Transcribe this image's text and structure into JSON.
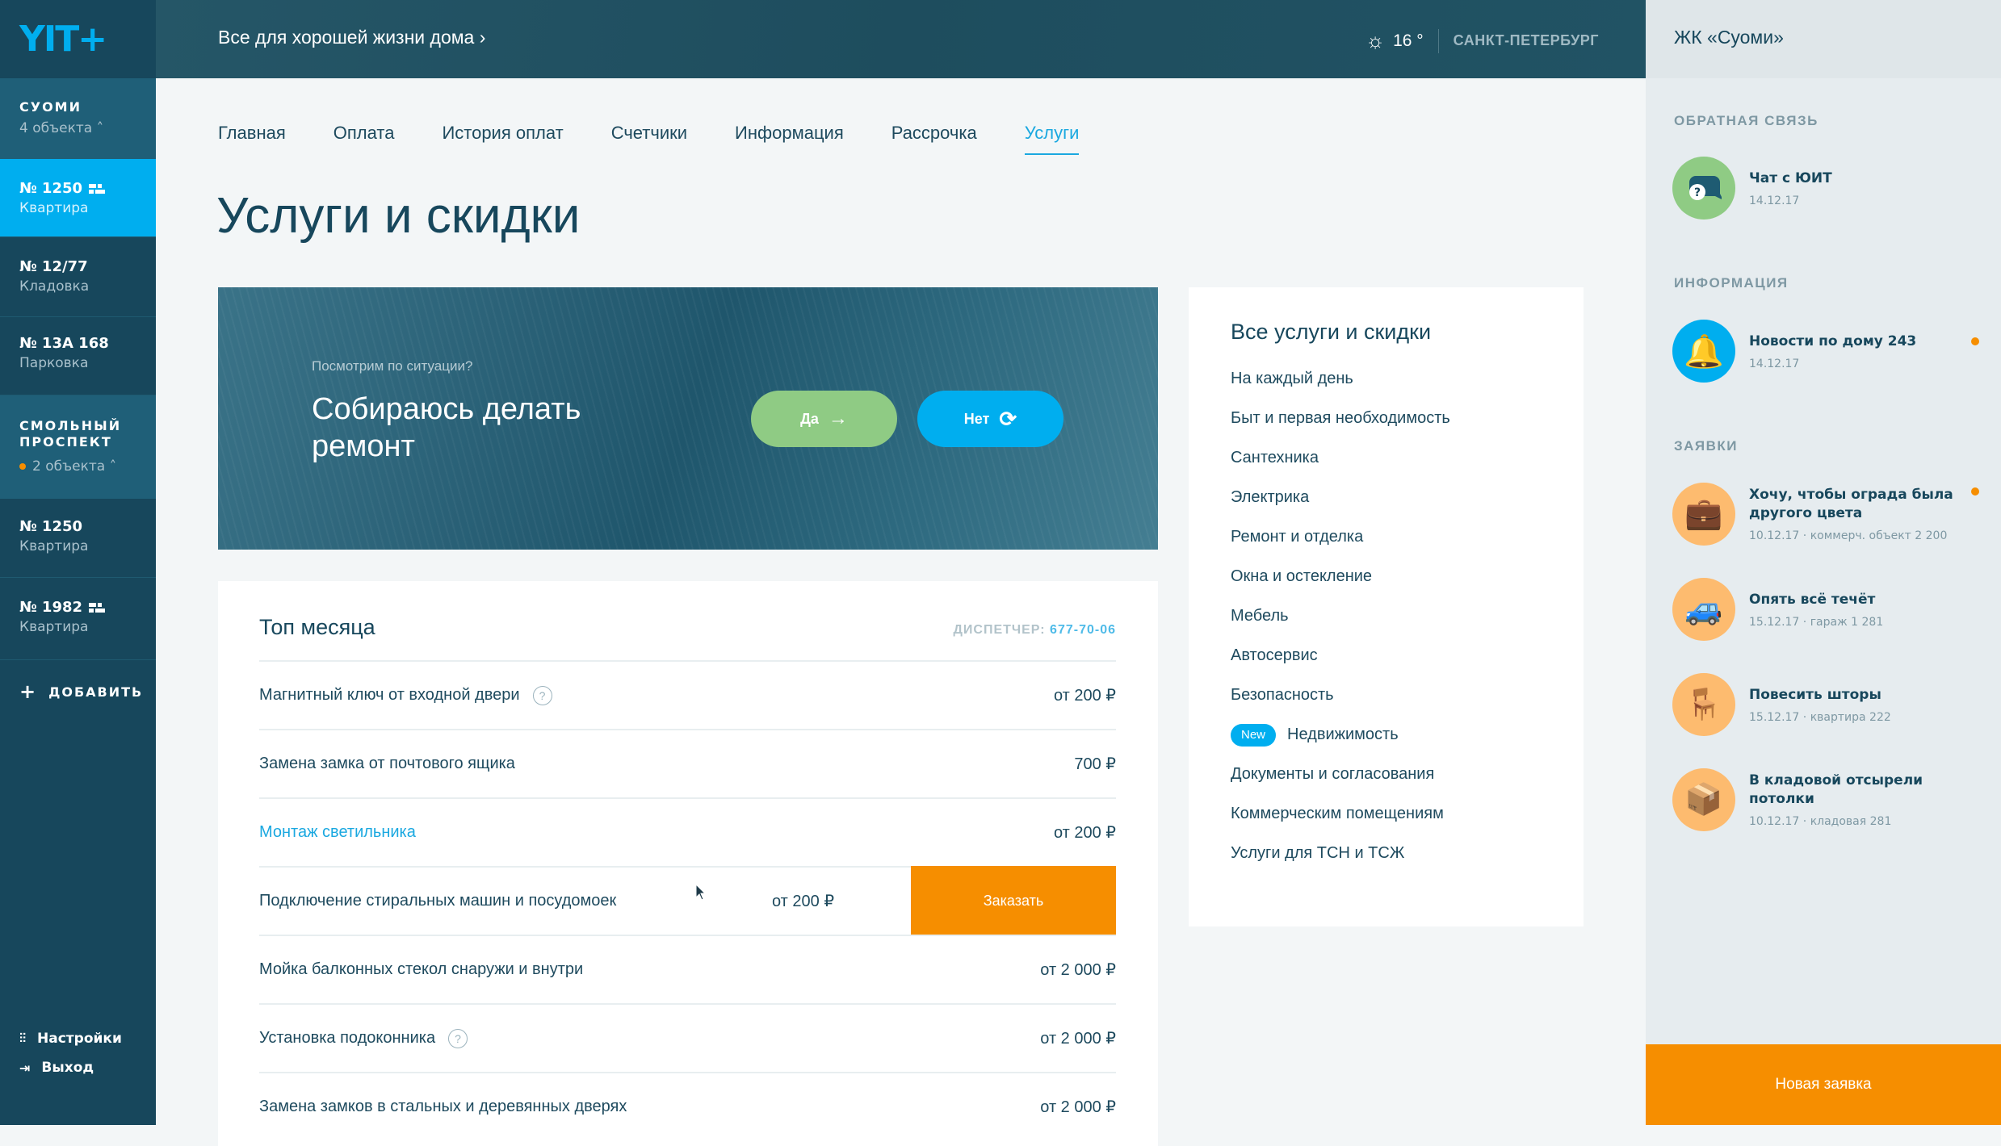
{
  "logo": "YIT+",
  "header": {
    "tagline": "Все для хорошей жизни дома",
    "temperature": "16 °",
    "city": "САНКТ-ПЕТЕРБУРГ"
  },
  "sidebar": {
    "groups": [
      {
        "title": "СУОМИ",
        "count": "4 объекта"
      },
      {
        "title": "СМОЛЬНЫЙ ПРОСПЕКТ",
        "count": "2 объекта"
      }
    ],
    "items": [
      {
        "number": "№ 1250",
        "kind": "Квартира"
      },
      {
        "number": "№ 12/77",
        "kind": "Кладовка"
      },
      {
        "number": "№ 13А 168",
        "kind": "Парковка"
      },
      {
        "number": "№ 1250",
        "kind": "Квартира"
      },
      {
        "number": "№ 1982",
        "kind": "Квартира"
      }
    ],
    "add": "ДОБАВИТЬ",
    "settings": "Настройки",
    "logout": "Выход"
  },
  "nav": [
    "Главная",
    "Оплата",
    "История оплат",
    "Счетчики",
    "Информация",
    "Рассрочка",
    "Услуги"
  ],
  "active_tab": "Услуги",
  "page_title": "Услуги и скидки",
  "banner": {
    "question": "Посмотрим по ситуации?",
    "headline": "Собираюсь делать ремонт",
    "yes": "Да",
    "no": "Нет"
  },
  "top": {
    "title": "Топ месяца",
    "dispatcher_label": "ДИСПЕТЧЕР:",
    "dispatcher_phone": "677-70-06",
    "order": "Заказать",
    "rows": [
      {
        "name": "Магнитный ключ от входной двери",
        "price": "от 200 ₽",
        "help": "?"
      },
      {
        "name": "Замена замка от почтового ящика",
        "price": "700 ₽"
      },
      {
        "name": "Монтаж светильника",
        "price": "от 200 ₽"
      },
      {
        "name": "Подключение стиральных машин и посудомоек",
        "price": "от 200 ₽"
      },
      {
        "name": "Мойка балконных стекол снаружи и внутри",
        "price": "от 2 000 ₽"
      },
      {
        "name": "Установка подоконника",
        "price": "от 2 000 ₽",
        "help": "?"
      },
      {
        "name": "Замена замков в стальных и деревянных дверях",
        "price": "от 2 000 ₽"
      }
    ]
  },
  "all": {
    "title": "Все услуги и скидки",
    "new_badge": "New",
    "categories": [
      "На каждый день",
      "Быт и первая необходимость",
      "Сантехника",
      "Электрика",
      "Ремонт и отделка",
      "Окна и остекление",
      "Мебель",
      "Автосервис",
      "Безопасность",
      "Недвижимость",
      "Документы и согласования",
      "Коммерческим помещениям",
      "Услуги для ТСН и ТСЖ"
    ]
  },
  "right": {
    "title": "ЖК «Суоми»",
    "feedback_label": "ОБРАТНАЯ СВЯЗЬ",
    "chat": {
      "title": "Чат с ЮИТ",
      "date": "14.12.17"
    },
    "info_label": "ИНФОРМАЦИЯ",
    "news": {
      "title": "Новости по дому 243",
      "date": "14.12.17"
    },
    "requests_label": "ЗАЯВКИ",
    "requests": [
      {
        "title": "Хочу, чтобы ограда была другого цвета",
        "date": "10.12.17",
        "place": "коммерч. объект 2 200"
      },
      {
        "title": "Опять всё течёт",
        "date": "15.12.17",
        "place": "гараж 1 281"
      },
      {
        "title": "Повесить шторы",
        "date": "15.12.17",
        "place": "квартира 222"
      },
      {
        "title": "В кладовой отсырели потолки",
        "date": "10.12.17",
        "place": "кладовая 281"
      }
    ],
    "new_request": "Новая заявка"
  },
  "colors": {
    "accent": "#00aeef",
    "orange": "#f68e00",
    "green": "#8fcb84",
    "dark": "#17475c"
  }
}
